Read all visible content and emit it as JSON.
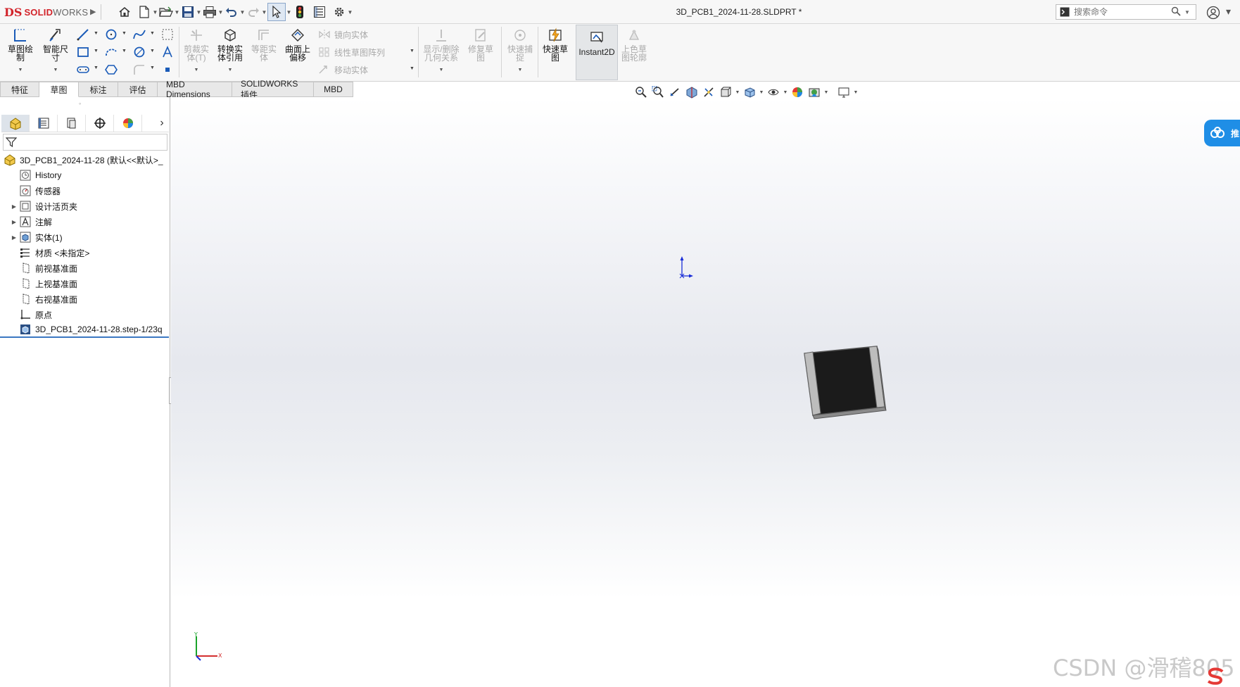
{
  "app": {
    "logo_ds": "DS",
    "logo_solid": "SOLID",
    "logo_works": "WORKS",
    "doc_title": "3D_PCB1_2024-11-28.SLDPRT *",
    "search_placeholder": "搜索命令",
    "brand_color": "#d2232a"
  },
  "quick_access": {
    "icons": [
      "home-icon",
      "new-doc-icon",
      "open-icon",
      "save-icon",
      "print-icon",
      "undo-icon",
      "redo-icon",
      "select-icon",
      "traffic-light-icon",
      "file-props-icon",
      "options-gear-icon"
    ]
  },
  "ribbon": {
    "sketch": "草图绘\n制",
    "smart_dim": "智能尺\n寸",
    "trim": "剪裁实\n体(T)",
    "convert": "转换实\n体引用",
    "offset": "等距实\n体",
    "surface_offset": "曲面上\n偏移",
    "mirror": "镜向实体",
    "linear_pattern": "线性草图阵列",
    "move": "移动实体",
    "show_delete": "显示/删除\n几何关系",
    "repair": "修复草\n图",
    "quick_snap": "快速捕\n捉",
    "rapid_sketch": "快速草\n图",
    "instant2d": "Instant2D",
    "shaded_contour": "上色草\n图轮廓"
  },
  "tabs": [
    {
      "label": "特征",
      "active": false
    },
    {
      "label": "草图",
      "active": true
    },
    {
      "label": "标注",
      "active": false
    },
    {
      "label": "评估",
      "active": false
    },
    {
      "label": "MBD Dimensions",
      "active": false
    },
    {
      "label": "SOLIDWORKS 插件",
      "active": false
    },
    {
      "label": "MBD",
      "active": false
    }
  ],
  "tree": {
    "root": "3D_PCB1_2024-11-28  (默认<<默认>_",
    "items": [
      {
        "label": "History",
        "expandable": false,
        "icon": "history-icon"
      },
      {
        "label": "传感器",
        "expandable": false,
        "icon": "sensor-icon"
      },
      {
        "label": "设计活页夹",
        "expandable": true,
        "icon": "binder-icon"
      },
      {
        "label": "注解",
        "expandable": true,
        "icon": "annotation-icon"
      },
      {
        "label": "实体(1)",
        "expandable": true,
        "icon": "solid-bodies-icon"
      },
      {
        "label": "材质 <未指定>",
        "expandable": false,
        "icon": "material-icon"
      },
      {
        "label": "前视基准面",
        "expandable": false,
        "icon": "plane-icon"
      },
      {
        "label": "上视基准面",
        "expandable": false,
        "icon": "plane-icon"
      },
      {
        "label": "右视基准面",
        "expandable": false,
        "icon": "plane-icon"
      },
      {
        "label": "原点",
        "expandable": false,
        "icon": "origin-icon"
      },
      {
        "label": "3D_PCB1_2024-11-28.step-1/23q",
        "expandable": false,
        "icon": "imported-body-icon"
      }
    ]
  },
  "viewport": {
    "side_badge": "推",
    "watermark": "CSDN @滑稽805",
    "triad_x": "X",
    "triad_y": "Y"
  }
}
